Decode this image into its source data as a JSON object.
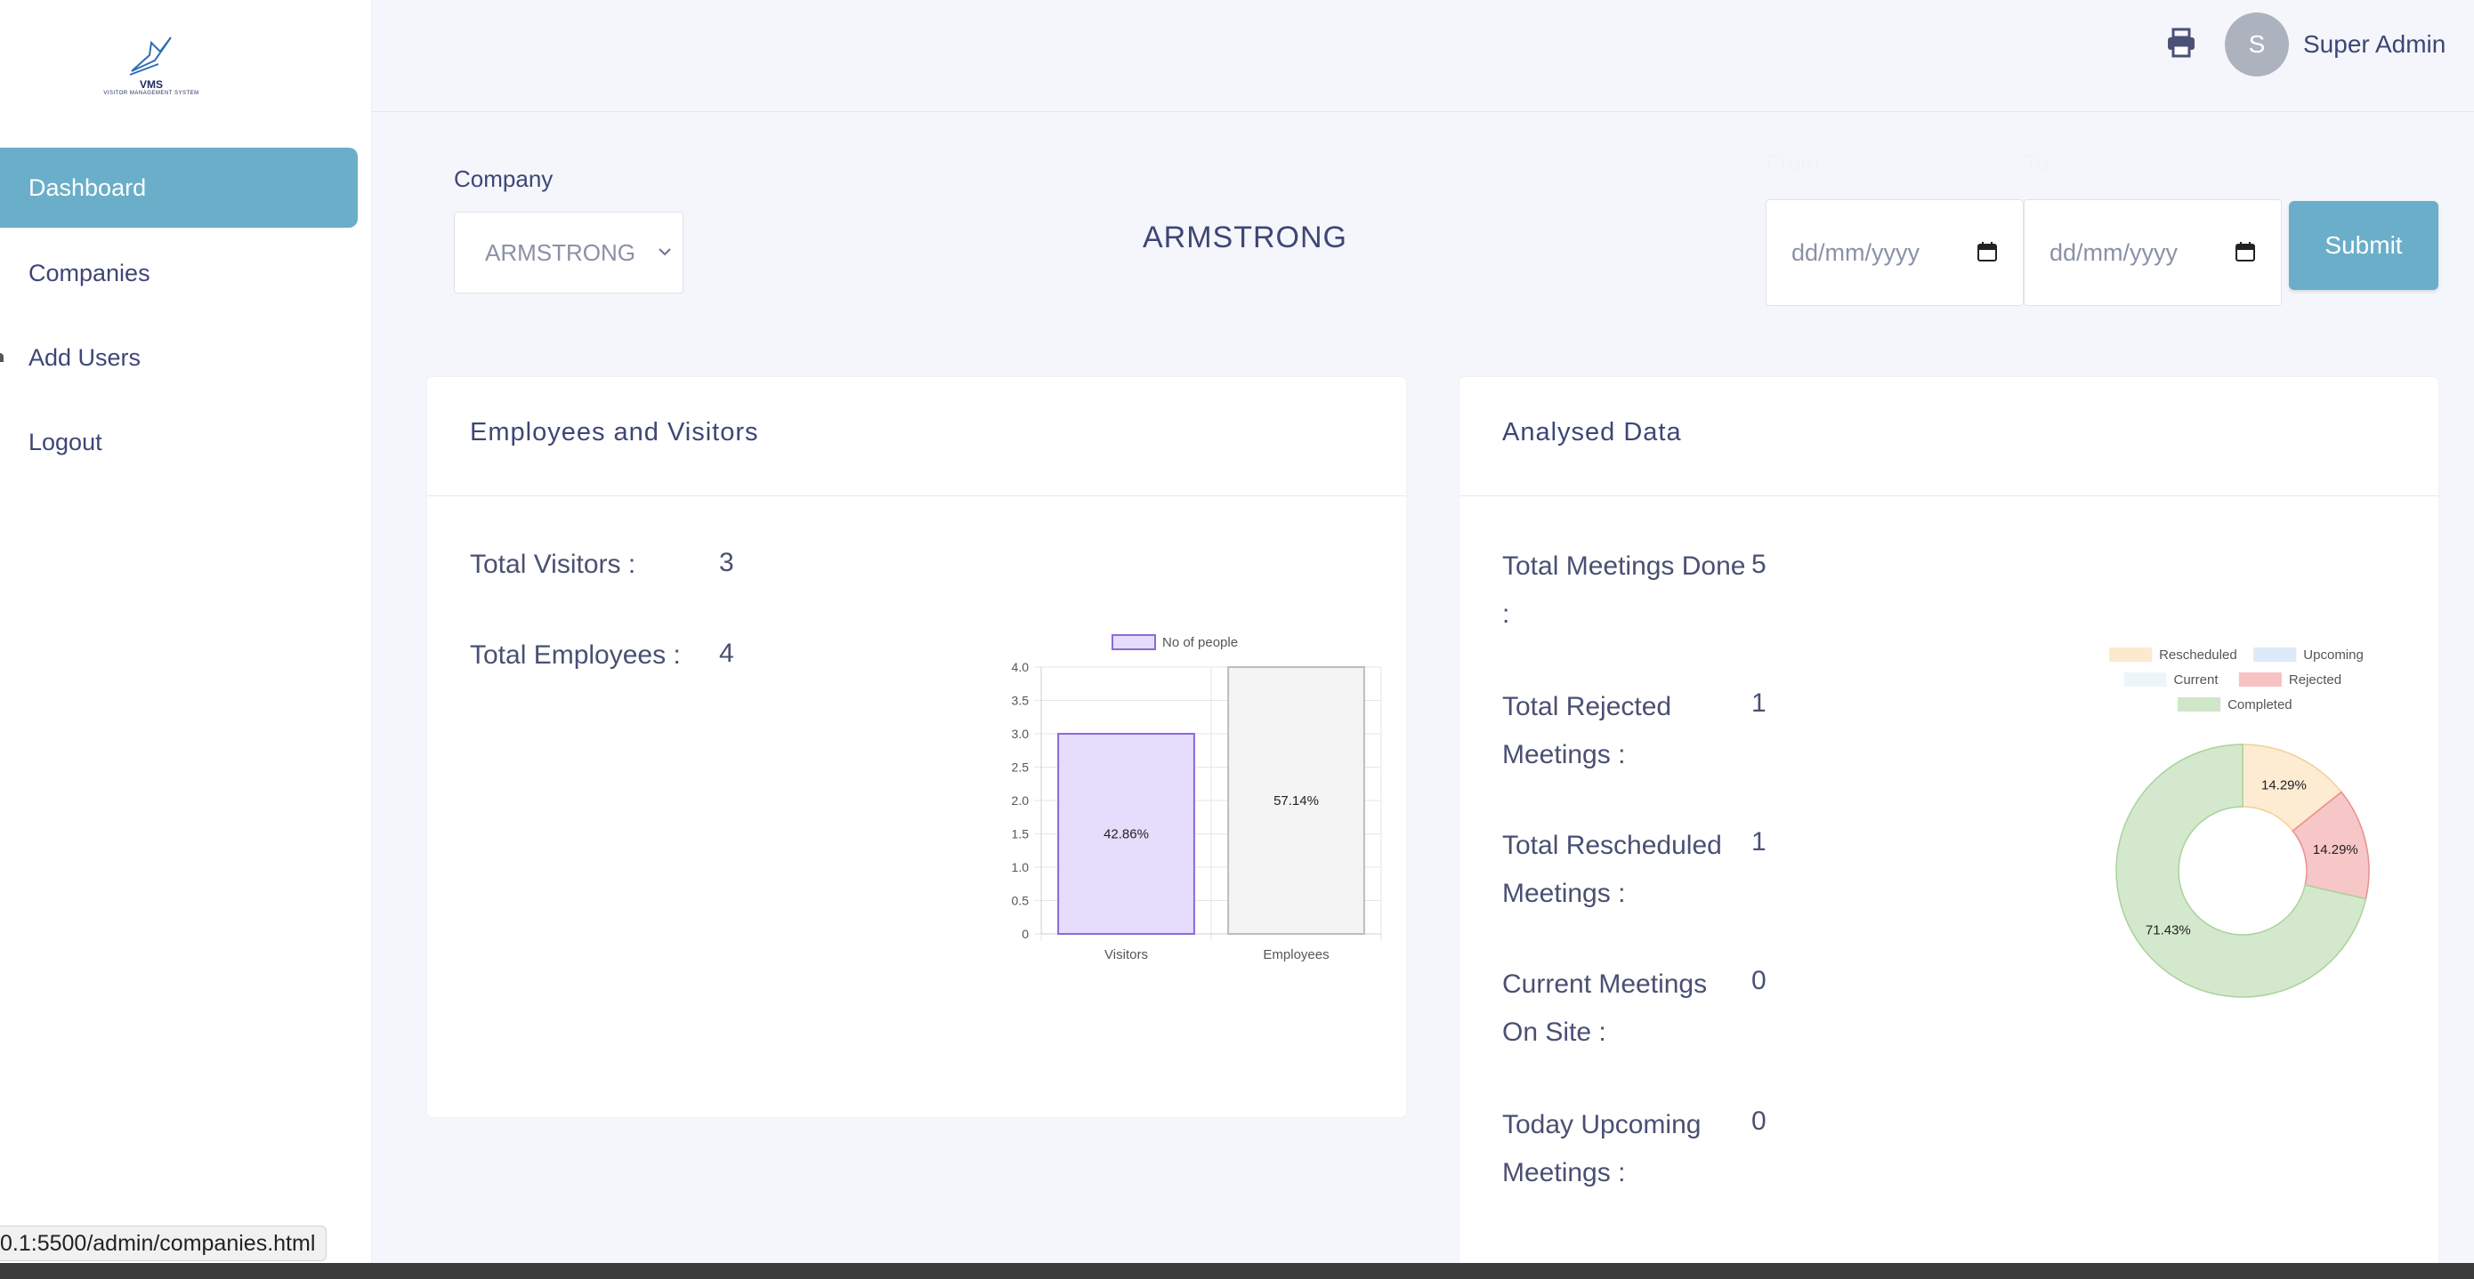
{
  "logo": {
    "title": "VMS",
    "subtitle": "VISITOR MANAGEMENT SYSTEM"
  },
  "sidebar": {
    "items": [
      {
        "label": "Dashboard",
        "active": true
      },
      {
        "label": "Companies",
        "active": false
      },
      {
        "label": "Add Users",
        "active": false
      },
      {
        "label": "Logout",
        "active": false
      }
    ]
  },
  "header": {
    "user": {
      "initial": "S",
      "name": "Super Admin"
    },
    "icons": [
      "print-icon"
    ]
  },
  "filters": {
    "company_label": "Company",
    "company_selected": "ARMSTRONG",
    "company_title": "ARMSTRONG",
    "from_label": "From",
    "to_label": "To",
    "from_placeholder": "dd/mm/yyyy",
    "to_placeholder": "dd/mm/yyyy",
    "submit_label": "Submit"
  },
  "employees_card": {
    "title": "Employees and Visitors",
    "stats": [
      {
        "label": "Total Visitors :",
        "value": "3"
      },
      {
        "label": "Total Employees :",
        "value": "4"
      }
    ]
  },
  "analysed_card": {
    "title": "Analysed Data",
    "stats": [
      {
        "label_lines": [
          "Total Meetings Done",
          ":"
        ],
        "value": "5"
      },
      {
        "label_lines": [
          "Total Rejected",
          "Meetings :"
        ],
        "value": "1"
      },
      {
        "label_lines": [
          "Total Rescheduled",
          "Meetings :"
        ],
        "value": "1"
      },
      {
        "label_lines": [
          "Current Meetings",
          "On Site :"
        ],
        "value": "0"
      },
      {
        "label_lines": [
          "Today Upcoming",
          "Meetings :"
        ],
        "value": "0"
      }
    ]
  },
  "status_url": "0.1:5500/admin/companies.html",
  "colors": {
    "accent": "#6aaec9",
    "text": "#3e4676",
    "bar_visitors_fill": "#e6dcfb",
    "bar_visitors_stroke": "#8a6ad9",
    "bar_employees_fill": "#f3f4f3",
    "bar_employees_stroke": "#bdbdbd"
  },
  "chart_data": [
    {
      "type": "bar",
      "legend": [
        "No of people"
      ],
      "categories": [
        "Visitors",
        "Employees"
      ],
      "values": [
        3,
        4
      ],
      "data_labels": [
        "42.86%",
        "57.14%"
      ],
      "yticks": [
        "0",
        "0.5",
        "1.0",
        "1.5",
        "2.0",
        "2.5",
        "3.0",
        "3.5",
        "4.0"
      ],
      "ylim": [
        0,
        4
      ],
      "grid": true,
      "legend_position": "top"
    },
    {
      "type": "pie",
      "variant": "doughnut",
      "legend": [
        "Rescheduled",
        "Upcoming",
        "Current",
        "Rejected",
        "Completed"
      ],
      "legend_colors": [
        "#fde9cf",
        "#dbe9f8",
        "#edf5fa",
        "#f6c2c2",
        "#cfe7c8"
      ],
      "slices": [
        {
          "name": "Rescheduled",
          "value": 14.29,
          "label": "14.29%",
          "color": "#fdebd2",
          "stroke": "#f5cf95"
        },
        {
          "name": "Rejected",
          "value": 14.29,
          "label": "14.29%",
          "color": "#f7c6c6",
          "stroke": "#e99090"
        },
        {
          "name": "Completed",
          "value": 71.43,
          "label": "71.43%",
          "color": "#d3e8cc",
          "stroke": "#a9d39c"
        }
      ],
      "legend_position": "top"
    }
  ]
}
